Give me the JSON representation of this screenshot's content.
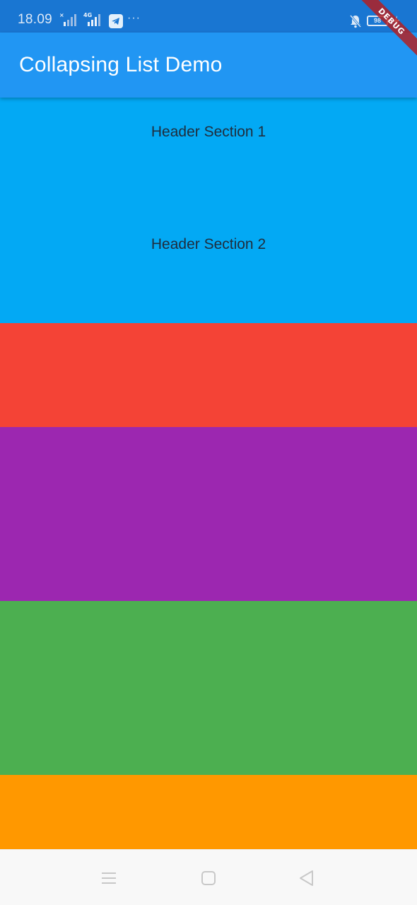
{
  "status_bar": {
    "time": "18.09",
    "network_1": "×",
    "network_2": "4G",
    "more": "···",
    "battery": "98",
    "icons": [
      "signal-icon",
      "telegram-icon",
      "mute-bell-icon",
      "battery-icon",
      "charging-icon"
    ]
  },
  "app_bar": {
    "title": "Collapsing List Demo"
  },
  "debug_banner": "DEBUG",
  "sections": [
    {
      "label": "Header Section 1",
      "color": "#03a9f4"
    },
    {
      "label": "Header Section 2",
      "color": "#03a9f4"
    }
  ],
  "blocks": [
    {
      "color": "#f44336"
    },
    {
      "color": "#9c27b0"
    },
    {
      "color": "#4caf50"
    },
    {
      "color": "#ff9800"
    }
  ],
  "nav_bar": {
    "icons": [
      "menu-icon",
      "home-square-icon",
      "back-triangle-icon"
    ]
  }
}
